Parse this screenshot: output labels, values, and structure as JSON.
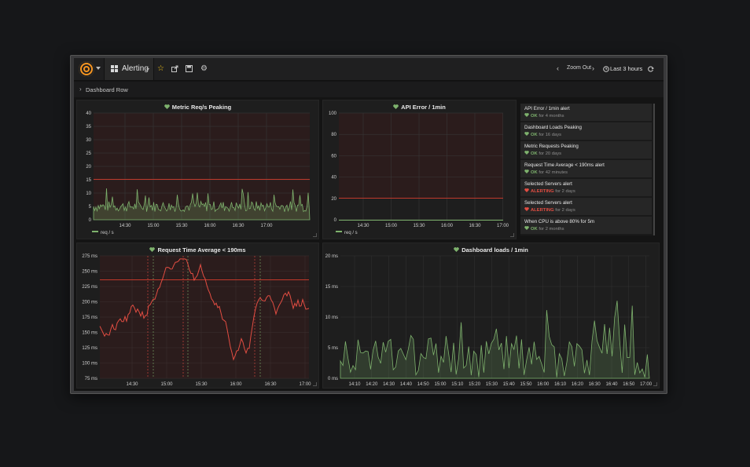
{
  "navbar": {
    "dashboard_title": "Alerting",
    "zoom_out_label": "Zoom Out",
    "time_range_label": "Last 3 hours"
  },
  "row": {
    "title": "Dashboard Row"
  },
  "panels": {
    "req": {
      "title": "Metric Req/s Peaking",
      "legend": "req / s",
      "y_ticks": [
        "40",
        "35",
        "30",
        "25",
        "20",
        "15",
        "10",
        "5",
        "0"
      ],
      "x_ticks": [
        "14:30",
        "15:00",
        "15:30",
        "16:00",
        "16:30",
        "17:00"
      ]
    },
    "api": {
      "title": "API Error / 1min",
      "legend": "req / s",
      "y_ticks": [
        "100",
        "80",
        "60",
        "40",
        "20",
        "0"
      ],
      "x_ticks": [
        "14:30",
        "15:00",
        "15:30",
        "16:00",
        "16:30",
        "17:00"
      ]
    },
    "rt": {
      "title": "Request Time Average < 190ms",
      "y_ticks": [
        "275 ms",
        "250 ms",
        "225 ms",
        "200 ms",
        "175 ms",
        "150 ms",
        "125 ms",
        "100 ms",
        "75 ms"
      ],
      "x_ticks": [
        "14:30",
        "15:00",
        "15:30",
        "16:00",
        "16:30",
        "17:00"
      ]
    },
    "dl": {
      "title": "Dashboard loads / 1min",
      "y_ticks": [
        "20 ms",
        "15 ms",
        "10 ms",
        "5 ms",
        "0 ms"
      ],
      "x_ticks": [
        "14:10",
        "14:20",
        "14:30",
        "14:40",
        "14:50",
        "15:00",
        "15:10",
        "15:20",
        "15:30",
        "15:40",
        "15:50",
        "16:00",
        "16:10",
        "16:20",
        "16:30",
        "16:40",
        "16:50",
        "17:00"
      ]
    }
  },
  "alerts": [
    {
      "name": "API Error / 1min alert",
      "state": "OK",
      "duration": "for 4 months"
    },
    {
      "name": "Dashboard Loads Peaking",
      "state": "OK",
      "duration": "for 16 days"
    },
    {
      "name": "Metric Requests Peaking",
      "state": "OK",
      "duration": "for 20 days"
    },
    {
      "name": "Request Time Average < 190ms alert",
      "state": "OK",
      "duration": "for 42 minutes"
    },
    {
      "name": "Selected Servers alert",
      "state": "ALERTING",
      "duration": "for 2 days"
    },
    {
      "name": "Selected Servers alert",
      "state": "ALERTING",
      "duration": "for 2 days"
    },
    {
      "name": "When CPU is above 80% for 5m",
      "state": "OK",
      "duration": "for 2 months"
    }
  ],
  "colors": {
    "ok": "#7eb26d",
    "alerting": "#e24d42",
    "logo": "#f79520",
    "line_red": "#e24d42",
    "line_green": "#7eb26d"
  },
  "icons": [
    "grafana-logo-icon",
    "dashboard-grid-icon",
    "star-icon",
    "share-icon",
    "save-icon",
    "gear-icon",
    "chevron-left-icon",
    "chevron-right-icon",
    "clock-icon",
    "refresh-icon",
    "chevron-right-icon",
    "heart-icon"
  ]
}
